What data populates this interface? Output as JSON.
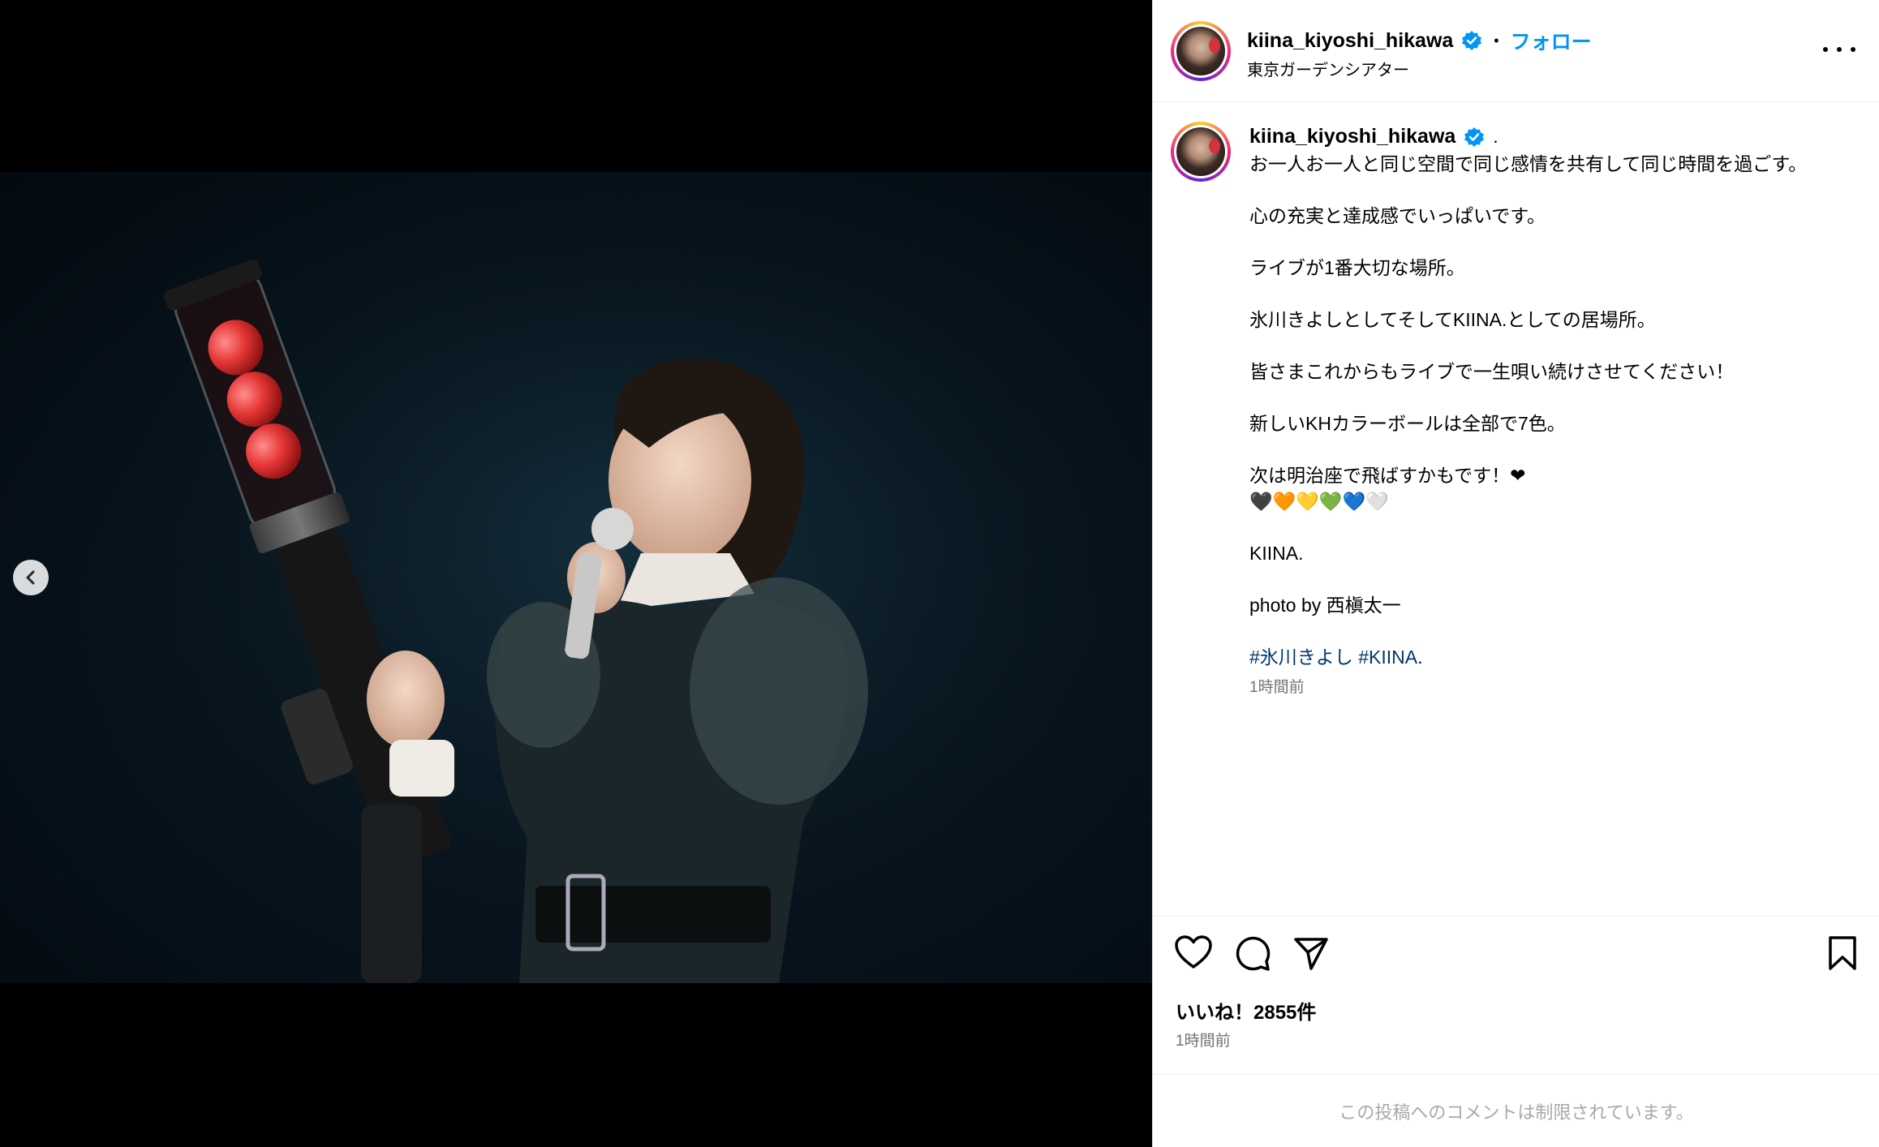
{
  "header": {
    "username": "kiina_kiyoshi_hikawa",
    "separator": "•",
    "follow_label": "フォロー",
    "location": "東京ガーデンシアター"
  },
  "caption": {
    "username": "kiina_kiyoshi_hikawa",
    "first_line_suffix": ".",
    "lines": [
      "お一人お一人と同じ空間で同じ感情を共有して同じ時間を過ごす。",
      "心の充実と達成感でいっぱいです。",
      "ライブが1番大切な場所。",
      "氷川きよしとしてそしてKIINA.としての居場所。",
      "皆さまこれからもライブで一生唄い続けさせてください！",
      "新しいKHカラーボールは全部で7色。",
      "次は明治座で飛ばすかもです！❤",
      "🖤🧡💛💚💙🤍",
      "KIINA.",
      "photo by 西槇太一"
    ],
    "hashtag_1": "#氷川きよし",
    "hashtag_2": "#KIINA",
    "hashtag_suffix": ".",
    "time": "1時間前"
  },
  "actions": {
    "like_icon": "heart-icon",
    "comment_icon": "comment-icon",
    "share_icon": "send-icon",
    "save_icon": "bookmark-icon"
  },
  "likes": "いいね！2855件",
  "post_time": "1時間前",
  "comments_disabled": "この投稿へのコメントは制限されています。",
  "colors": {
    "link_blue": "#0095f6",
    "hashtag": "#00376b",
    "muted": "#737373",
    "verified": "#0095f6"
  }
}
